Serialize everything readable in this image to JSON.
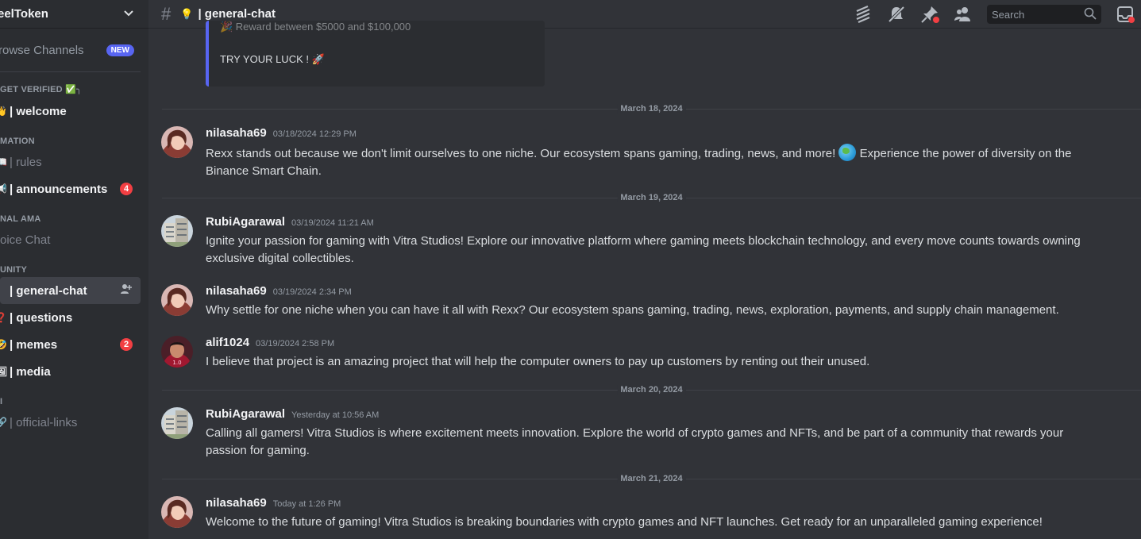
{
  "server": {
    "name": "eelToken",
    "chevron_icon": "chevron-down-icon"
  },
  "browse": {
    "label": "rowse Channels",
    "badge": "NEW"
  },
  "sidebar": {
    "sections": [
      {
        "category": "GET VERIFIED ✅╮",
        "channels": [
          {
            "emoji": "👋",
            "label": "| welcome",
            "style": "bold"
          }
        ]
      },
      {
        "category": "MATION",
        "channels": [
          {
            "emoji": "📖",
            "label": "| rules",
            "style": "muted"
          },
          {
            "emoji": "📢",
            "label": "| announcements",
            "style": "bold",
            "count": "4"
          }
        ]
      },
      {
        "category": "NAL AMA",
        "channels": [
          {
            "emoji": "",
            "label": "oice Chat",
            "style": "muted"
          }
        ]
      },
      {
        "category": "UNITY",
        "channels": [
          {
            "emoji": "",
            "label": "| general-chat",
            "style": "active",
            "action_icon": "add-member-icon"
          },
          {
            "emoji": "❓",
            "label": "| questions",
            "style": "bold"
          },
          {
            "emoji": "🤣",
            "label": "| memes",
            "style": "bold",
            "count": "2"
          },
          {
            "emoji": "🖼",
            "label": "| media",
            "style": "bold"
          }
        ]
      },
      {
        "category": "I",
        "channels": [
          {
            "emoji": "🔗",
            "label": "| official-links",
            "style": "muted"
          }
        ]
      }
    ]
  },
  "topbar": {
    "title": "| general-chat",
    "search_placeholder": "Search",
    "icons": [
      "threads-icon",
      "mute-icon",
      "pin-icon",
      "members-icon",
      "search-icon",
      "inbox-icon"
    ]
  },
  "embed": {
    "line1": "🎉 Reward between $5000 and $100,000",
    "line2": "TRY YOUR LUCK ! 🚀"
  },
  "dividers": [
    "March 18, 2024",
    "March 19, 2024",
    "March 20, 2024",
    "March 21, 2024"
  ],
  "messages": [
    {
      "user": "nilasaha69",
      "time": "03/18/2024 12:29 PM",
      "text_a": "Rexx stands out because we don't limit ourselves to one niche. Our ecosystem spans gaming, trading, news, and more!",
      "text_b": "Experience the power of diversity on the Binance Smart Chain.",
      "avatar": "avatar-nila"
    },
    {
      "user": "RubiAgarawal",
      "time": "03/19/2024 11:21 AM",
      "text": "Ignite your passion for gaming with Vitra Studios! Explore our innovative platform where gaming meets blockchain technology, and every move counts towards owning exclusive digital collectibles.",
      "avatar": "avatar-rubi"
    },
    {
      "user": "nilasaha69",
      "time": "03/19/2024 2:34 PM",
      "text": "Why settle for one niche when you can have it all with Rexx? Our ecosystem spans gaming, trading, news, exploration, payments, and supply chain management.",
      "avatar": "avatar-nila"
    },
    {
      "user": "alif1024",
      "time": "03/19/2024 2:58 PM",
      "text": "I believe that project is an amazing project that will help the computer owners to pay up customers by renting out their unused.",
      "avatar": "avatar-alif"
    },
    {
      "user": "RubiAgarawal",
      "time": "Yesterday at 10:56 AM",
      "text": "Calling all gamers! Vitra Studios is where excitement meets innovation. Explore the world of crypto games and NFTs, and be part of a community that rewards your passion for gaming.",
      "avatar": "avatar-rubi"
    },
    {
      "user": "nilasaha69",
      "time": "Today at 1:26 PM",
      "text": "Welcome to the future of gaming! Vitra Studios is breaking boundaries with crypto games and NFT launches. Get ready for an unparalleled gaming experience!",
      "avatar": "avatar-nila"
    }
  ]
}
